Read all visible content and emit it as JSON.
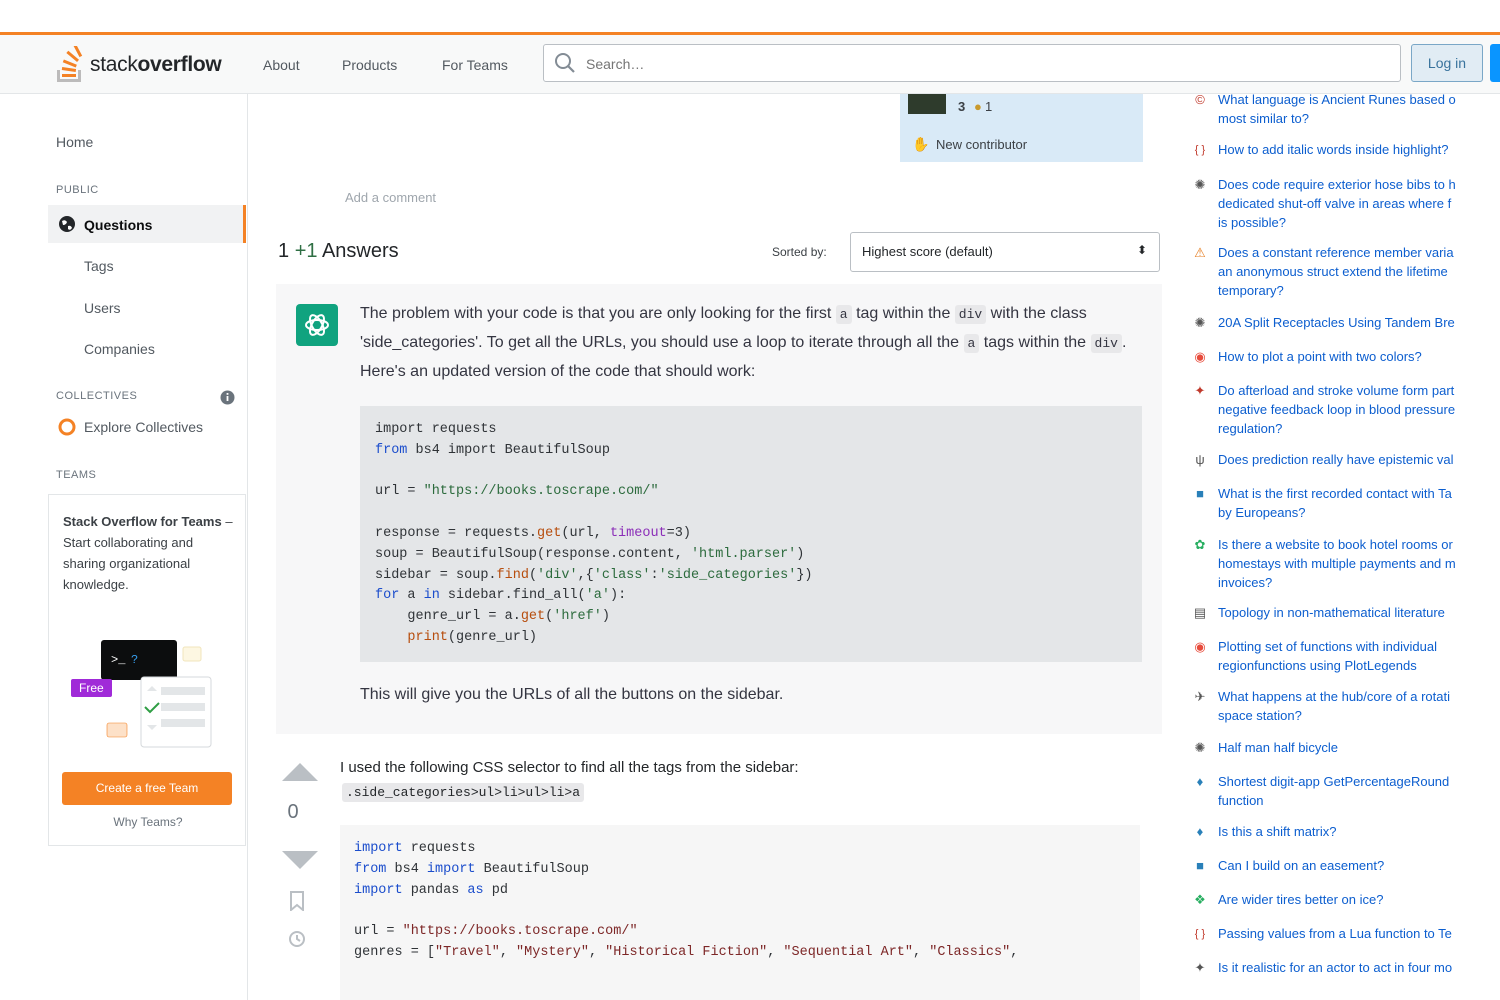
{
  "header": {
    "logo_plain": "stack",
    "logo_bold": "overflow",
    "nav": [
      "About",
      "Products",
      "For Teams"
    ],
    "search_placeholder": "Search…",
    "login_label": "Log in"
  },
  "leftnav": {
    "home": "Home",
    "public_heading": "PUBLIC",
    "questions": "Questions",
    "tags": "Tags",
    "users": "Users",
    "companies": "Companies",
    "collectives_heading": "COLLECTIVES",
    "explore_collectives": "Explore Collectives",
    "teams_heading": "TEAMS",
    "teams_title": "Stack Overflow for Teams",
    "teams_desc": " – Start collaborating and sharing organizational knowledge.",
    "free_badge": "Free",
    "create_team": "Create a free Team",
    "why_teams": "Why Teams?"
  },
  "author_card": {
    "reputation": "3",
    "badge_count": "1",
    "new_contributor": "New contributor"
  },
  "question": {
    "add_comment": "Add a comment"
  },
  "answers": {
    "count": "1",
    "plus": "+1",
    "label": "Answers",
    "sorted_by_label": "Sorted by:",
    "sort_value": "Highest score (default)"
  },
  "gpt_answer": {
    "p1": "The problem with your code is that you are only looking for the first",
    "code_a": "a",
    "p2": "tag within the",
    "code_div": "div",
    "p3": "with the class 'side_categories'. To get all the URLs, you should use a loop to iterate through all the",
    "code_a2": "a",
    "p4": "tags within the",
    "code_div2": "div",
    "p5": ". Here's an updated version of the code that should work:",
    "footer": "This will give you the URLs of all the buttons on the sidebar."
  },
  "second_answer": {
    "vote_count": "0",
    "text": "I used the following CSS selector to find all the tags from the sidebar:",
    "selector": ".side_categories>ul>li>ul>li>a"
  },
  "hot_network_questions": [
    {
      "icon": "©",
      "color": "#c0392b",
      "title": "What language is Ancient Runes based o\nmost similar to?"
    },
    {
      "icon": "{ }",
      "color": "#c0392b",
      "title": "How to add italic words inside highlight?"
    },
    {
      "icon": "✺",
      "color": "#555555",
      "title": "Does code require exterior hose bibs to h\ndedicated shut-off valve in areas where f\nis possible?"
    },
    {
      "icon": "⚠",
      "color": "#e67e22",
      "title": "Does a constant reference member varia\nan anonymous struct extend the lifetime\ntemporary?"
    },
    {
      "icon": "✺",
      "color": "#555555",
      "title": "20A Split Receptacles Using Tandem Bre"
    },
    {
      "icon": "◉",
      "color": "#e74c3c",
      "title": "How to plot a point with two colors?"
    },
    {
      "icon": "✦",
      "color": "#c0392b",
      "title": "Do afterload and stroke volume form part\nnegative feedback loop in blood pressure\nregulation?"
    },
    {
      "icon": "ψ",
      "color": "#555555",
      "title": "Does prediction really have epistemic val"
    },
    {
      "icon": "■",
      "color": "#2980b9",
      "title": "What is the first recorded contact with Ta\nby Europeans?"
    },
    {
      "icon": "✿",
      "color": "#27ae60",
      "title": "Is there a website to book hotel rooms or\nhomestays with multiple payments and m\ninvoices?"
    },
    {
      "icon": "▤",
      "color": "#555555",
      "title": "Topology in non-mathematical literature"
    },
    {
      "icon": "◉",
      "color": "#e74c3c",
      "title": "Plotting set of functions with individual\nregionfunctions using PlotLegends"
    },
    {
      "icon": "✈",
      "color": "#555555",
      "title": "What happens at the hub/core of a rotati\nspace station?"
    },
    {
      "icon": "✺",
      "color": "#555555",
      "title": "Half man half bicycle"
    },
    {
      "icon": "♦",
      "color": "#2980b9",
      "title": "Shortest digit-app GetPercentageRound\nfunction"
    },
    {
      "icon": "♦",
      "color": "#2980b9",
      "title": "Is this a shift matrix?"
    },
    {
      "icon": "■",
      "color": "#2980b9",
      "title": "Can I build on an easement?"
    },
    {
      "icon": "❖",
      "color": "#27ae60",
      "title": "Are wider tires better on ice?"
    },
    {
      "icon": "{ }",
      "color": "#c0392b",
      "title": "Passing values from a Lua function to Te"
    },
    {
      "icon": "✦",
      "color": "#555555",
      "title": "Is it realistic for an actor to act in four mo"
    }
  ],
  "colors": {
    "accent": "#f48225",
    "link": "#0c5ecf",
    "gpt_green": "#10a37f"
  }
}
